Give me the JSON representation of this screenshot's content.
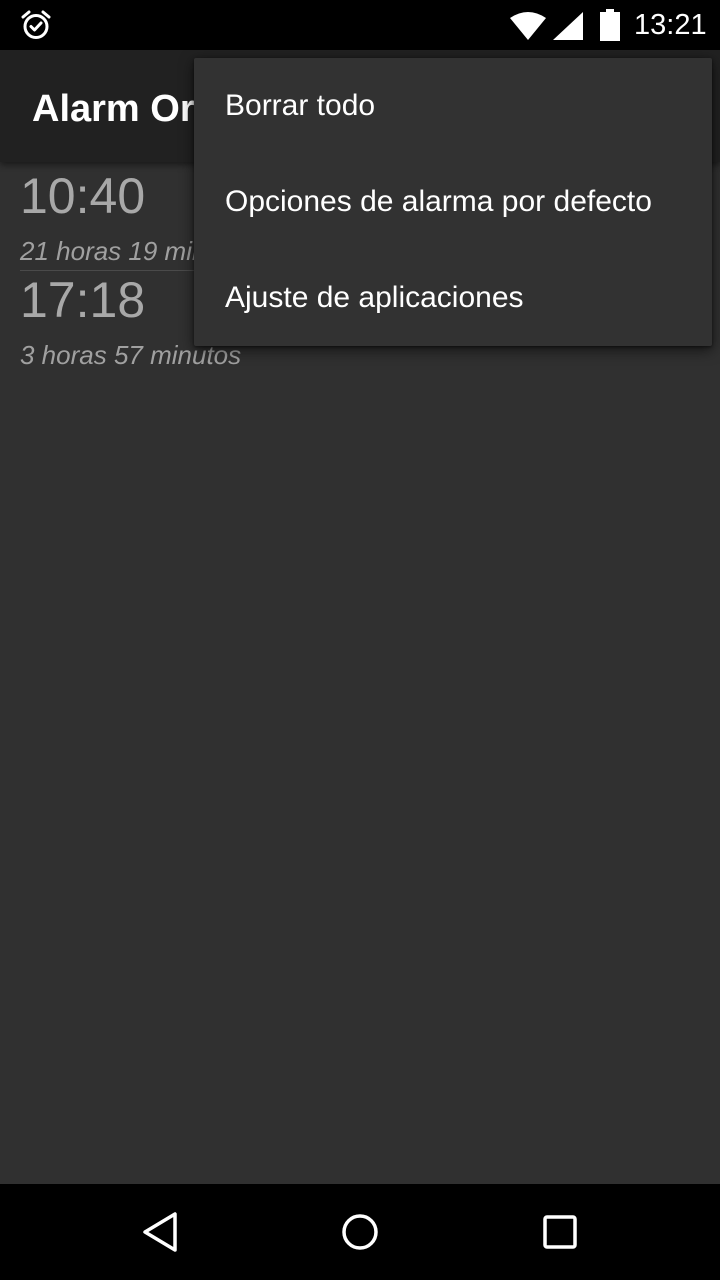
{
  "status_bar": {
    "time": "13:21",
    "icons": [
      "alarm-clock-icon",
      "wifi-icon",
      "signal-icon",
      "battery-icon"
    ]
  },
  "app_bar": {
    "title": "Alarm Organizer"
  },
  "alarms": [
    {
      "time": "10:40",
      "remaining": "21 horas 19 minutos"
    },
    {
      "time": "17:18",
      "remaining": "3 horas 57 minutos"
    }
  ],
  "overflow_menu": {
    "items": [
      {
        "label": "Borrar todo"
      },
      {
        "label": "Opciones de alarma por defecto"
      },
      {
        "label": "Ajuste de aplicaciones"
      }
    ]
  },
  "nav_bar": {
    "icons": [
      "back-icon",
      "home-icon",
      "recents-icon"
    ]
  },
  "colors": {
    "background": "#303030",
    "app_bar": "#212121",
    "menu": "#323232",
    "status_bar": "#000000",
    "alarm_text": "#a8a8a8"
  }
}
